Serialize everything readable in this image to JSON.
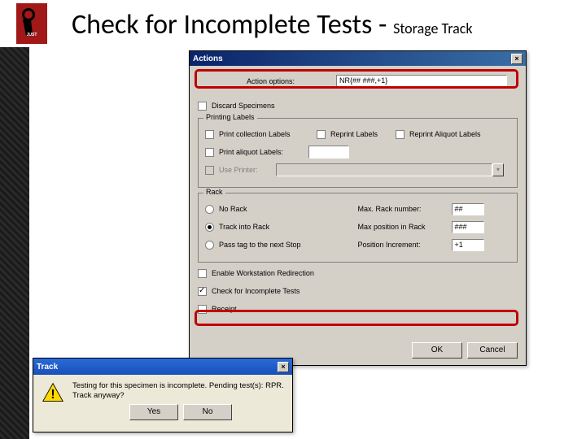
{
  "slide": {
    "title_main": "Check for Incomplete Tests - ",
    "title_sub": "Storage Track"
  },
  "actions_dialog": {
    "title": "Actions",
    "action_options_label": "Action options:",
    "action_options_value": "NR{## ###,+1}",
    "discard_specimens": "Discard Specimens",
    "printing_labels_legend": "Printing Labels",
    "print_collection_labels": "Print collection Labels",
    "reprint_labels": "Reprint Labels",
    "reprint_aliquot_labels": "Reprint Aliquot Labels",
    "print_aliquot_labels": "Print aliquot Labels:",
    "use_printer": "Use Printer:",
    "rack_legend": "Rack",
    "no_rack": "No Rack",
    "track_into_rack": "Track into Rack",
    "pass_tag": "Pass tag to the next Stop",
    "max_rack_number": "Max. Rack number:",
    "max_rack_number_val": "##",
    "max_position": "Max position in Rack",
    "max_position_val": "###",
    "position_increment": "Position Increment:",
    "position_increment_val": "+1",
    "enable_workstation": "Enable Workstation Redirection",
    "check_incomplete": "Check for Incomplete Tests",
    "receipt": "Receipt",
    "ok": "OK",
    "cancel": "Cancel"
  },
  "track_dialog": {
    "title": "Track",
    "message_line1": "Testing for this specimen is incomplete. Pending test(s): RPR.",
    "message_line2": "Track anyway?",
    "yes": "Yes",
    "no": "No"
  }
}
